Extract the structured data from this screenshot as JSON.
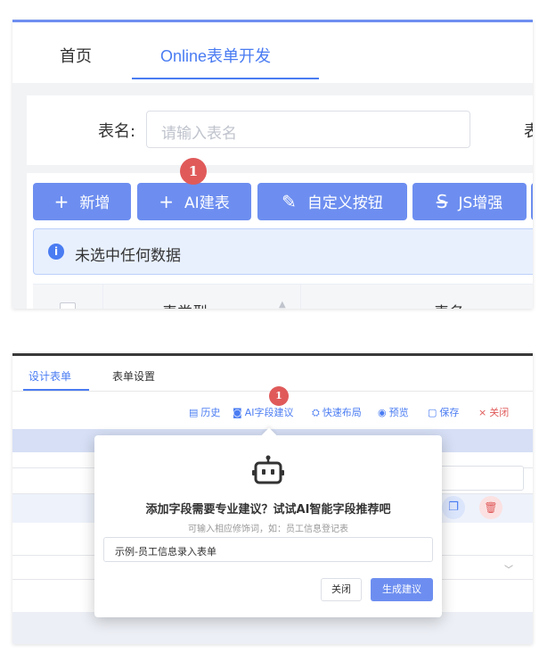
{
  "panel1": {
    "tabs": [
      {
        "label": "首页"
      },
      {
        "label": "Online表单开发"
      }
    ],
    "form": {
      "label": "表名:",
      "placeholder": "请输入表名",
      "label2": "表"
    },
    "toolbar": {
      "buttons": [
        {
          "icon": "+",
          "label": "新增"
        },
        {
          "icon": "+",
          "label": "AI建表"
        },
        {
          "icon": "✎",
          "label": "自定义按钮"
        },
        {
          "icon": "S",
          "label": "JS增强"
        }
      ],
      "badge": "1"
    },
    "alert": {
      "icon": "i",
      "text": "未选中任何数据"
    },
    "table": {
      "columns": [
        "表类型",
        "表名"
      ]
    }
  },
  "panel2": {
    "tabs": [
      {
        "label": "设计表单"
      },
      {
        "label": "表单设置"
      }
    ],
    "toolbar": {
      "history": {
        "icon": "▤",
        "label": "历史"
      },
      "ai_suggest": {
        "icon": "◙",
        "label": "AI字段建议"
      },
      "quick_layout": {
        "icon": "⛭",
        "label": "快速布局"
      },
      "preview": {
        "icon": "◉",
        "label": "预览"
      },
      "save": {
        "icon": "▢",
        "label": "保存"
      },
      "close": {
        "icon": "×",
        "label": "关闭"
      },
      "badge": "1"
    },
    "dialog": {
      "title": "添加字段需要专业建议？试试AI智能字段推荐吧",
      "hint": "可输入相应修饰词，如：员工信息登记表",
      "input_value": "示例-员工信息录入表单",
      "close_label": "关闭",
      "generate_label": "生成建议"
    }
  },
  "colors": {
    "primary": "#6d8ef0",
    "accent_text": "#4a7cf2",
    "badge": "#e05a5a",
    "alert_bg": "#e8f0fe"
  }
}
